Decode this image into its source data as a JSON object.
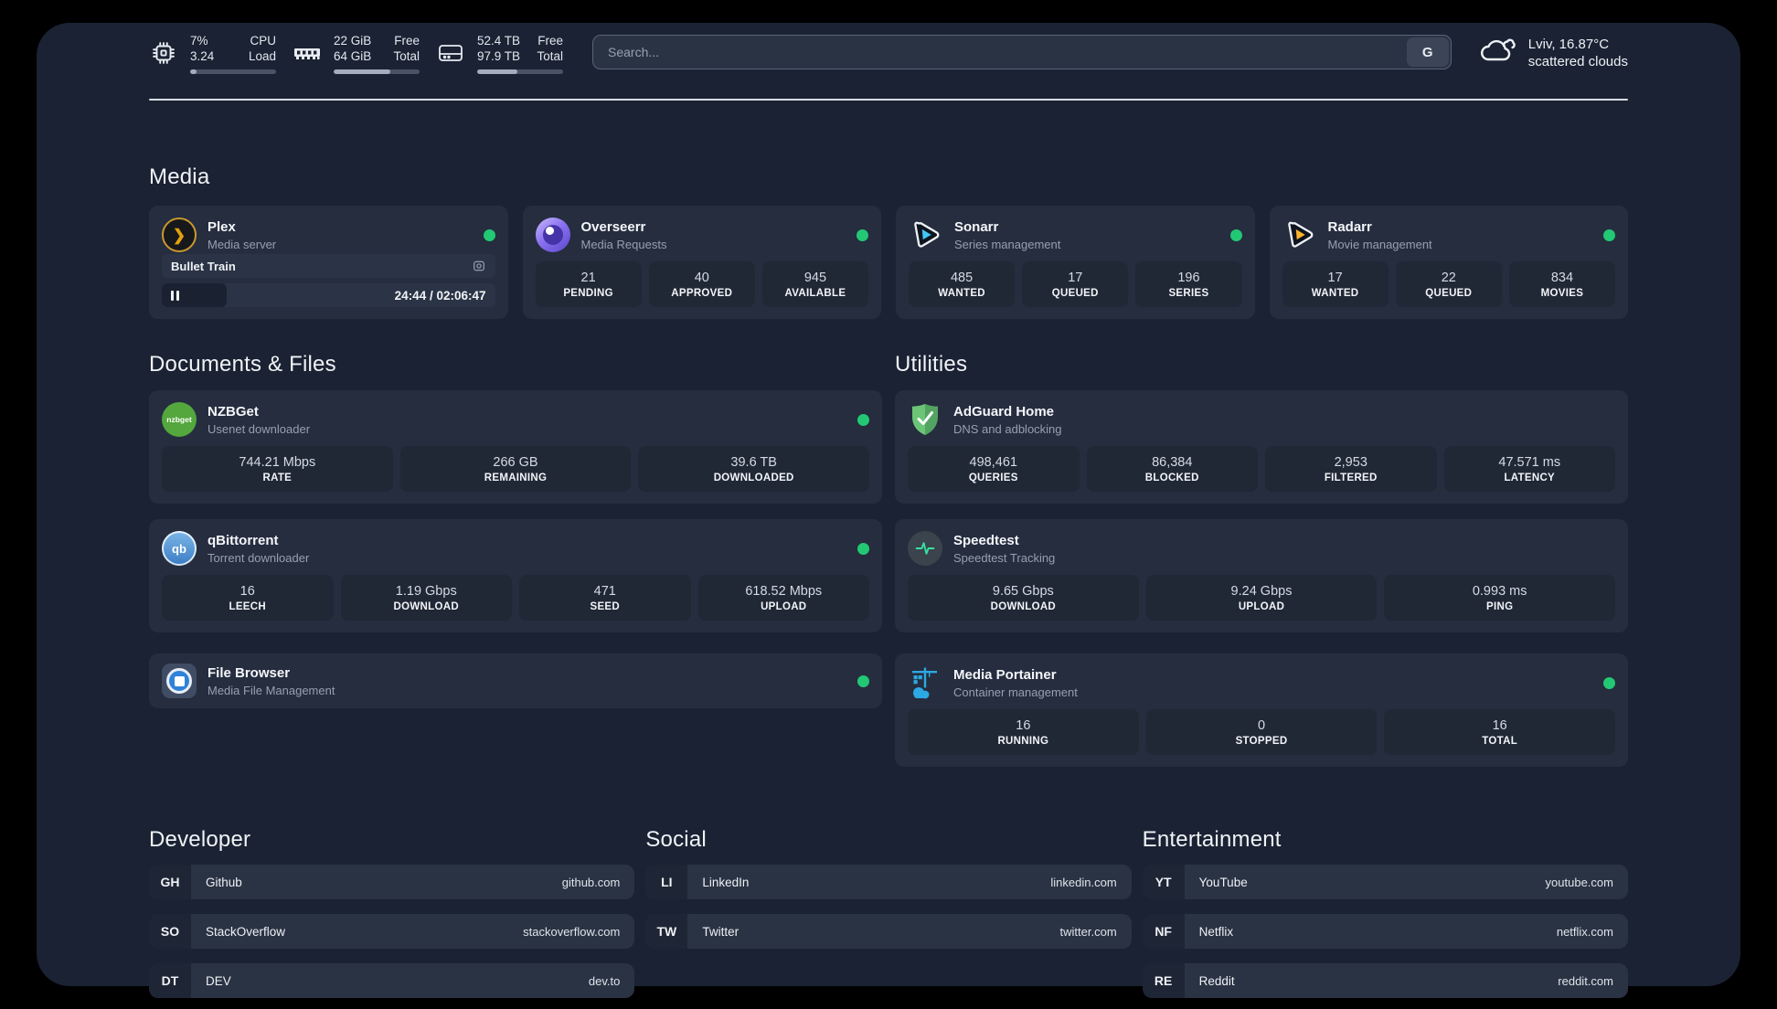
{
  "colors": {
    "online": "#22c873",
    "page_bg": "#1a2233",
    "card_bg": "#252d3f",
    "accent_plex": "#e5a00d",
    "accent_sonarr": "#41c7f4",
    "accent_radarr": "#fdb42d",
    "accent_speedtest": "#35e3a0",
    "accent_portainer": "#2ca9e2"
  },
  "header": {
    "system": [
      {
        "name": "cpu",
        "values": [
          "7%",
          "3.24"
        ],
        "labels": [
          "CPU",
          "Load"
        ],
        "progress": 7
      },
      {
        "name": "memory",
        "values": [
          "22 GiB",
          "64 GiB"
        ],
        "labels": [
          "Free",
          "Total"
        ],
        "progress": 66
      },
      {
        "name": "disk",
        "values": [
          "52.4 TB",
          "97.9 TB"
        ],
        "labels": [
          "Free",
          "Total"
        ],
        "progress": 47
      }
    ],
    "search": {
      "placeholder": "Search...",
      "button_label": "G"
    },
    "weather": {
      "location": "Lviv, 16.87°C",
      "condition": "scattered clouds"
    }
  },
  "media": {
    "title": "Media",
    "plex": {
      "name": "Plex",
      "desc": "Media server",
      "now_playing": "Bullet Train",
      "time": "24:44 / 02:06:47",
      "progress": 19.5
    },
    "overseerr": {
      "name": "Overseerr",
      "desc": "Media Requests",
      "stats": [
        {
          "value": "21",
          "label": "PENDING"
        },
        {
          "value": "40",
          "label": "APPROVED"
        },
        {
          "value": "945",
          "label": "AVAILABLE"
        }
      ]
    },
    "sonarr": {
      "name": "Sonarr",
      "desc": "Series management",
      "stats": [
        {
          "value": "485",
          "label": "WANTED"
        },
        {
          "value": "17",
          "label": "QUEUED"
        },
        {
          "value": "196",
          "label": "SERIES"
        }
      ]
    },
    "radarr": {
      "name": "Radarr",
      "desc": "Movie management",
      "stats": [
        {
          "value": "17",
          "label": "WANTED"
        },
        {
          "value": "22",
          "label": "QUEUED"
        },
        {
          "value": "834",
          "label": "MOVIES"
        }
      ]
    }
  },
  "documents": {
    "title": "Documents & Files",
    "nzbget": {
      "name": "NZBGet",
      "desc": "Usenet downloader",
      "icon_label": "nzbget",
      "stats": [
        {
          "value": "744.21 Mbps",
          "label": "RATE"
        },
        {
          "value": "266 GB",
          "label": "REMAINING"
        },
        {
          "value": "39.6 TB",
          "label": "DOWNLOADED"
        }
      ]
    },
    "qbittorrent": {
      "name": "qBittorrent",
      "desc": "Torrent downloader",
      "icon_label": "qb",
      "stats": [
        {
          "value": "16",
          "label": "LEECH"
        },
        {
          "value": "1.19 Gbps",
          "label": "DOWNLOAD"
        },
        {
          "value": "471",
          "label": "SEED"
        },
        {
          "value": "618.52 Mbps",
          "label": "UPLOAD"
        }
      ]
    },
    "filebrowser": {
      "name": "File Browser",
      "desc": "Media File Management"
    }
  },
  "utilities": {
    "title": "Utilities",
    "adguard": {
      "name": "AdGuard Home",
      "desc": "DNS and adblocking",
      "stats": [
        {
          "value": "498,461",
          "label": "QUERIES"
        },
        {
          "value": "86,384",
          "label": "BLOCKED"
        },
        {
          "value": "2,953",
          "label": "FILTERED"
        },
        {
          "value": "47.571 ms",
          "label": "LATENCY"
        }
      ]
    },
    "speedtest": {
      "name": "Speedtest",
      "desc": "Speedtest Tracking",
      "stats": [
        {
          "value": "9.65 Gbps",
          "label": "DOWNLOAD"
        },
        {
          "value": "9.24 Gbps",
          "label": "UPLOAD"
        },
        {
          "value": "0.993 ms",
          "label": "PING"
        }
      ]
    },
    "portainer": {
      "name": "Media Portainer",
      "desc": "Container management",
      "stats": [
        {
          "value": "16",
          "label": "RUNNING"
        },
        {
          "value": "0",
          "label": "STOPPED"
        },
        {
          "value": "16",
          "label": "TOTAL"
        }
      ]
    }
  },
  "links": {
    "columns": [
      {
        "title": "Developer",
        "items": [
          {
            "abbr": "GH",
            "name": "Github",
            "url": "github.com"
          },
          {
            "abbr": "SO",
            "name": "StackOverflow",
            "url": "stackoverflow.com"
          },
          {
            "abbr": "DT",
            "name": "DEV",
            "url": "dev.to"
          }
        ]
      },
      {
        "title": "Social",
        "items": [
          {
            "abbr": "LI",
            "name": "LinkedIn",
            "url": "linkedin.com"
          },
          {
            "abbr": "TW",
            "name": "Twitter",
            "url": "twitter.com"
          }
        ]
      },
      {
        "title": "Entertainment",
        "items": [
          {
            "abbr": "YT",
            "name": "YouTube",
            "url": "youtube.com"
          },
          {
            "abbr": "NF",
            "name": "Netflix",
            "url": "netflix.com"
          },
          {
            "abbr": "RE",
            "name": "Reddit",
            "url": "reddit.com"
          }
        ]
      }
    ]
  }
}
